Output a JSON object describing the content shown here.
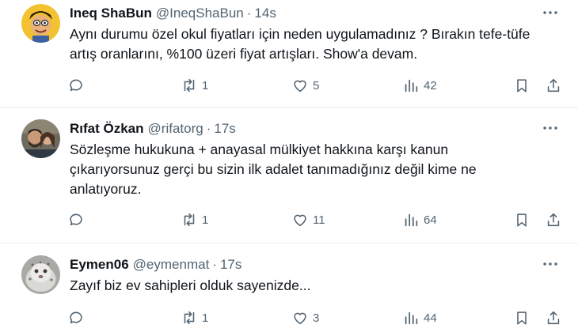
{
  "tweets": [
    {
      "name": "Ineq ShaBun",
      "handle": "@IneqShaBun",
      "separator": "·",
      "time": "14s",
      "text": "Aynı durumu özel okul fiyatları için neden uygulamadınız ? Bırakın tefe-tüfe\nartış oranlarını, %100 üzeri fiyat artışları. Show'a devam.",
      "reposts": "1",
      "likes": "5",
      "views": "42"
    },
    {
      "name": "Rıfat Özkan",
      "handle": "@rifatorg",
      "separator": "·",
      "time": "17s",
      "text": "Sözleşme hukukuna + anayasal mülkiyet hakkına karşı kanun\nçıkarıyorsunuz gerçi bu sizin ilk adalet tanımadığınız değil kime ne\nanlatıyoruz.",
      "reposts": "1",
      "likes": "11",
      "views": "64"
    },
    {
      "name": "Eymen06",
      "handle": "@eymenmat",
      "separator": "·",
      "time": "17s",
      "text": "Zayıf biz ev sahipleri olduk sayenizde...",
      "reposts": "1",
      "likes": "3",
      "views": "44"
    }
  ],
  "colors": {
    "text": "#0f1419",
    "secondary": "#536471",
    "divider": "#e6ecf0"
  }
}
